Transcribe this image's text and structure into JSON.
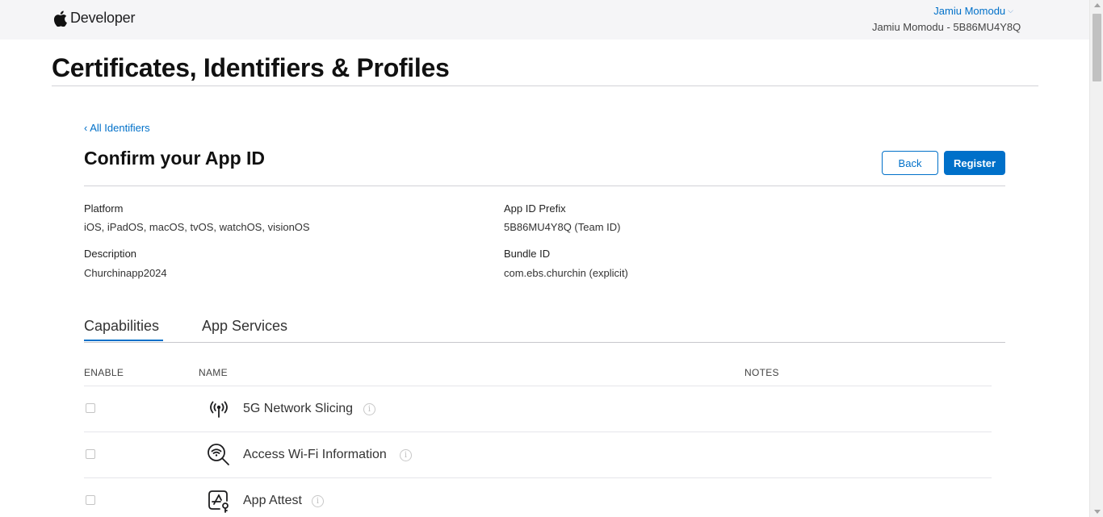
{
  "header": {
    "logo_text": "Developer",
    "account_name": "Jamiu Momodu",
    "team_line": "Jamiu Momodu - 5B86MU4Y8Q"
  },
  "page": {
    "title": "Certificates, Identifiers & Profiles"
  },
  "section": {
    "back_link": "‹ All Identifiers",
    "title": "Confirm your App ID",
    "back_button": "Back",
    "register_button": "Register"
  },
  "details": {
    "platform_label": "Platform",
    "platform_value": "iOS, iPadOS, macOS, tvOS, watchOS, visionOS",
    "prefix_label": "App ID Prefix",
    "prefix_value": "5B86MU4Y8Q (Team ID)",
    "description_label": "Description",
    "description_value": "Churchinapp2024",
    "bundle_label": "Bundle ID",
    "bundle_value": "com.ebs.churchin (explicit)"
  },
  "tabs": [
    {
      "label": "Capabilities",
      "active": true
    },
    {
      "label": "App Services",
      "active": false
    }
  ],
  "table": {
    "columns": {
      "enable": "ENABLE",
      "name": "NAME",
      "notes": "NOTES"
    },
    "rows": [
      {
        "name": "5G Network Slicing",
        "icon": "antenna-icon",
        "enabled": false
      },
      {
        "name": "Access Wi-Fi Information",
        "icon": "wifi-search-icon",
        "enabled": false
      },
      {
        "name": "App Attest",
        "icon": "app-attest-icon",
        "enabled": false
      }
    ]
  },
  "colors": {
    "accent": "#0070c9",
    "topbar_bg": "#f5f5f7"
  }
}
